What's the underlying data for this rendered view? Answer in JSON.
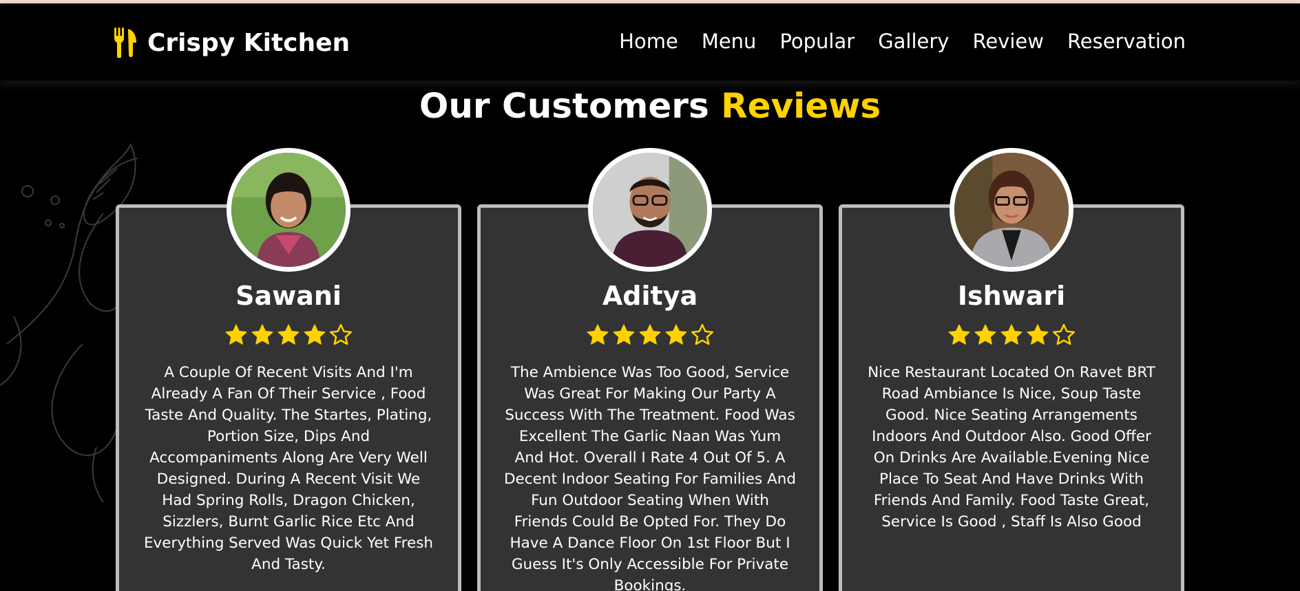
{
  "brand": {
    "name": "Crispy Kitchen",
    "icon": "fork-knife-icon",
    "icon_color": "#ffd200"
  },
  "nav": {
    "items": [
      "Home",
      "Menu",
      "Popular",
      "Gallery",
      "Review",
      "Reservation"
    ]
  },
  "section": {
    "title_main": "Our Customers",
    "title_accent": "Reviews",
    "accent_color": "#ffd200"
  },
  "reviews": [
    {
      "name": "Sawani",
      "rating": 4,
      "max_rating": 5,
      "text": "A Couple Of Recent Visits And I'm Already A Fan Of Their Service , Food Taste And Quality. The Startes, Plating, Portion Size, Dips And Accompaniments Along Are Very Well Designed. During A Recent Visit We Had Spring Rolls, Dragon Chicken, Sizzlers, Burnt Garlic Rice Etc And Everything Served Was Quick Yet Fresh And Tasty."
    },
    {
      "name": "Aditya",
      "rating": 4,
      "max_rating": 5,
      "text": "The Ambience Was Too Good, Service Was Great For Making Our Party A Success With The Treatment. Food Was Excellent The Garlic Naan Was Yum And Hot. Overall I Rate 4 Out Of 5. A Decent Indoor Seating For Families And Fun Outdoor Seating When With Friends Could Be Opted For. They Do Have A Dance Floor On 1st Floor But I Guess It's Only Accessible For Private Bookings."
    },
    {
      "name": "Ishwari",
      "rating": 4,
      "max_rating": 5,
      "text": "Nice Restaurant Located On Ravet BRT Road Ambiance Is Nice, Soup Taste Good. Nice Seating Arrangements Indoors And Outdoor Also. Good Offer On Drinks Are Available.Evening Nice Place To Seat And Have Drinks With Friends And Family. Food Taste Great, Service Is Good , Staff Is Also Good"
    }
  ],
  "colors": {
    "star": "#ffd200",
    "card_bg": "#333333",
    "card_border": "#bdbdbd"
  }
}
